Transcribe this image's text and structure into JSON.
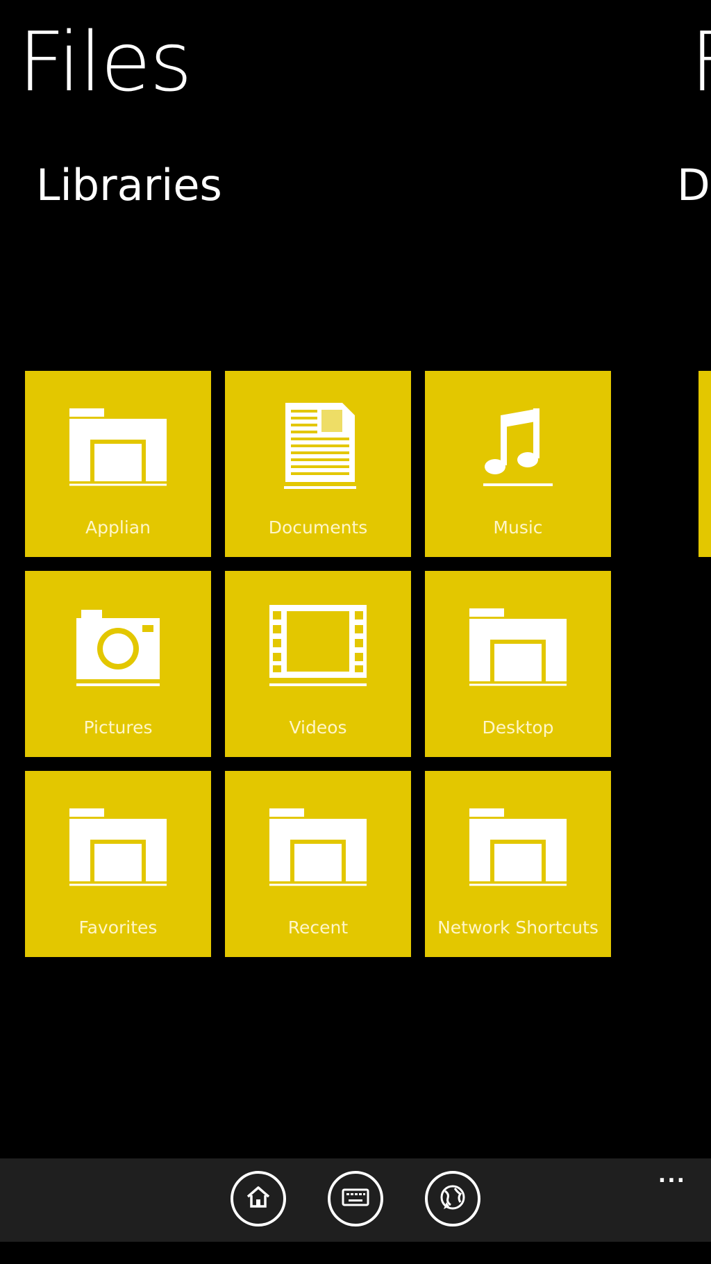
{
  "header": {
    "title": "Files",
    "next_title_peek": "F"
  },
  "section": {
    "title": "Libraries",
    "next_section_peek": "D"
  },
  "colors": {
    "accent": "#e3c700",
    "background": "#000000",
    "app_bar": "#1f1f1f"
  },
  "tiles": [
    {
      "label": "Applian",
      "icon": "folder-icon"
    },
    {
      "label": "Documents",
      "icon": "document-icon"
    },
    {
      "label": "Music",
      "icon": "music-note-icon"
    },
    {
      "label": "Pictures",
      "icon": "camera-icon"
    },
    {
      "label": "Videos",
      "icon": "film-icon"
    },
    {
      "label": "Desktop",
      "icon": "folder-icon"
    },
    {
      "label": "Favorites",
      "icon": "folder-icon"
    },
    {
      "label": "Recent",
      "icon": "folder-icon"
    },
    {
      "label": "Network Shortcuts",
      "icon": "folder-icon"
    }
  ],
  "app_bar": {
    "buttons": [
      {
        "icon": "home-icon"
      },
      {
        "icon": "keyboard-icon"
      },
      {
        "icon": "globe-icon"
      }
    ],
    "more_label": "..."
  }
}
